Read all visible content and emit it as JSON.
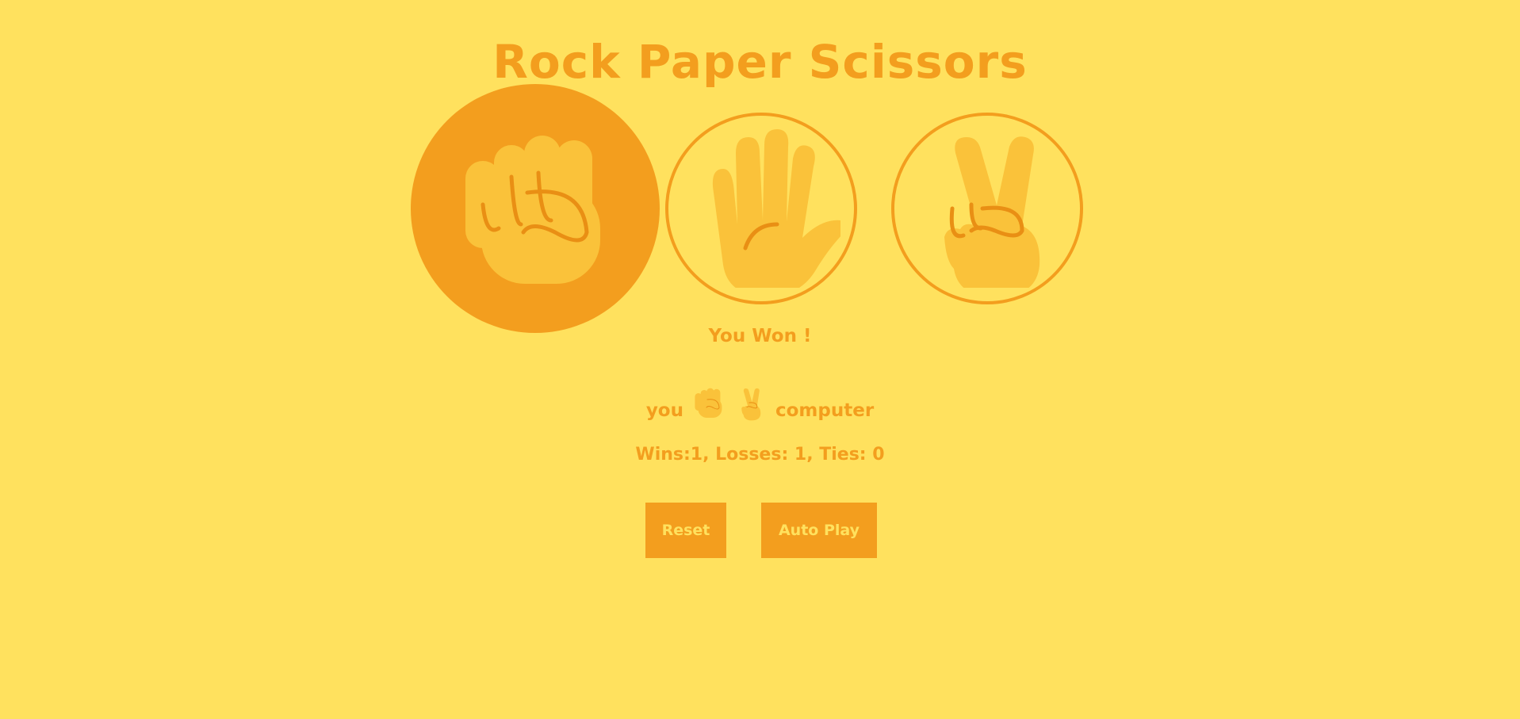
{
  "title": "Rock Paper Scissors",
  "choices": [
    {
      "name": "rock",
      "selected": true
    },
    {
      "name": "paper",
      "selected": false
    },
    {
      "name": "scissors",
      "selected": false
    }
  ],
  "result": "You Won !",
  "moves": {
    "you_label": "you",
    "you_icon": "rock-fist-icon",
    "computer_icon": "scissors-victory-hand-icon",
    "computer_label": "computer"
  },
  "score_text": "Wins:1, Losses: 1, Ties: 0",
  "buttons": {
    "reset": "Reset",
    "autoplay": "Auto Play"
  },
  "colors": {
    "background": "#FFE15E",
    "accent": "#F39E1E",
    "hand": "#FAC23A"
  }
}
